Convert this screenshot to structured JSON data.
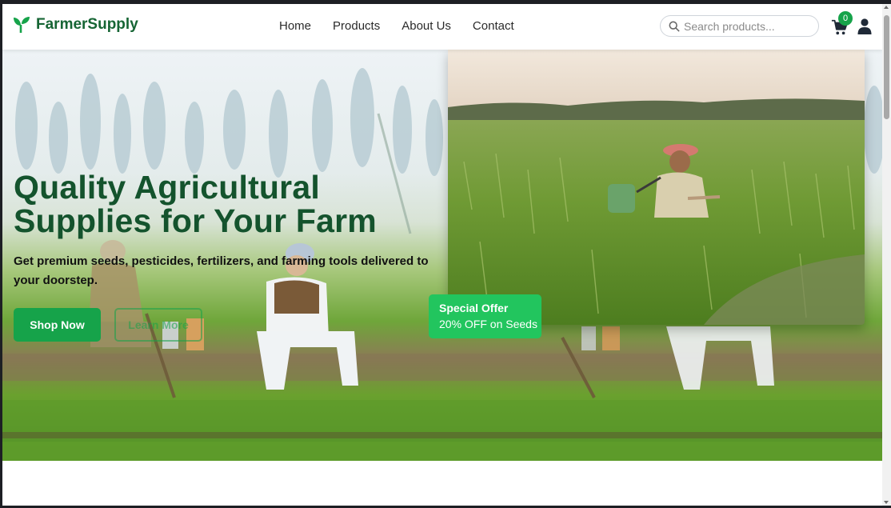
{
  "brand": {
    "name": "FarmerSupply",
    "logo_icon": "sprout-icon",
    "color": "#166534"
  },
  "nav": [
    {
      "label": "Home"
    },
    {
      "label": "Products"
    },
    {
      "label": "About Us"
    },
    {
      "label": "Contact"
    }
  ],
  "search": {
    "placeholder": "Search products...",
    "value": "",
    "icon": "search-icon"
  },
  "cart": {
    "count": "0",
    "icon": "shopping-cart-icon"
  },
  "user": {
    "icon": "user-icon"
  },
  "hero": {
    "title": "Quality Agricultural Supplies for Your Farm",
    "subtitle": "Get premium seeds, pesticides, fertilizers, and farming tools delivered to your doorstep.",
    "primary_button": "Shop Now",
    "secondary_button": "Learn More",
    "offer_title": "Special Offer",
    "offer_text": "20% OFF on Seeds"
  },
  "colors": {
    "accent": "#16a34a",
    "offer": "#22c55e",
    "title": "#14532d"
  }
}
